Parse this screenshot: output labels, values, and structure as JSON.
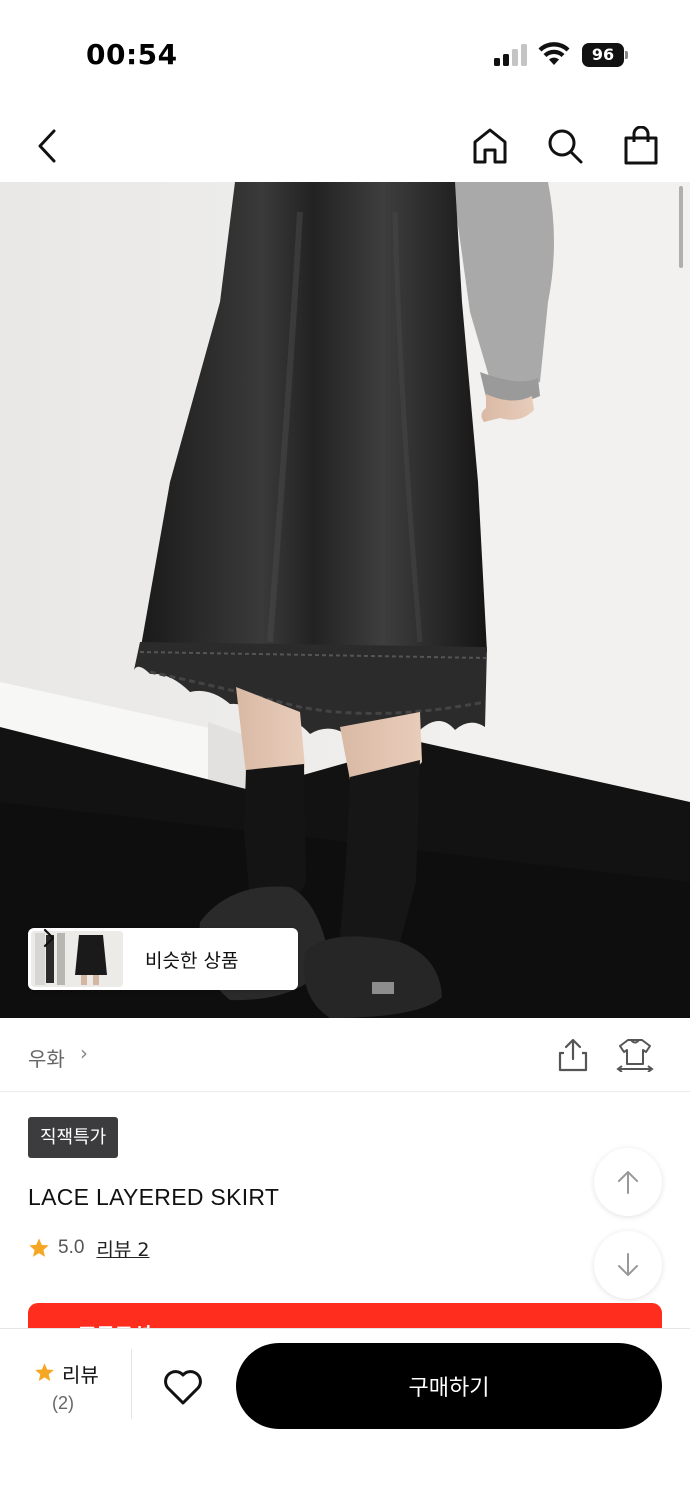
{
  "status_bar": {
    "time": "00:54",
    "battery": "96",
    "icons": [
      "signal-icon",
      "wifi-icon",
      "battery-icon"
    ]
  },
  "nav": {
    "icons": [
      "back-icon",
      "home-icon",
      "search-icon",
      "shopping-bag-icon"
    ]
  },
  "hero": {
    "similar_label": "비슷한 상품",
    "similar_icon": "chevron-right-icon"
  },
  "brand": {
    "name": "우화",
    "chevron": "›",
    "icons": [
      "share-icon",
      "try-on-icon"
    ]
  },
  "product": {
    "badge": "직잭특가",
    "name": "LACE LAYERED SKIRT",
    "rating": "5.0",
    "review_link": "리뷰 2"
  },
  "promo": {
    "text": "프로모션",
    "color": "#ff2d1e"
  },
  "scroll_buttons": {
    "icons": [
      "arrow-up-icon",
      "arrow-down-icon"
    ]
  },
  "bottom_bar": {
    "review_label": "리뷰",
    "review_count": "(2)",
    "buy_label": "구매하기",
    "icons": [
      "star-icon",
      "heart-icon"
    ]
  },
  "colors": {
    "accent_star": "#f5a623",
    "buy_button": "#000000",
    "badge": "#3c3c3e"
  }
}
